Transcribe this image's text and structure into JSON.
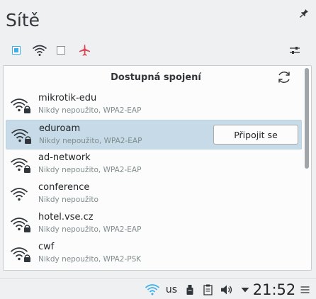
{
  "popup": {
    "title": "Sítě",
    "header_label": "Dostupná spojení",
    "toolbar": {
      "icons": [
        "enable-networking-checkbox-icon",
        "wifi-icon",
        "mobile-broadband-checkbox-icon",
        "airplane-mode-icon",
        "configure-icon"
      ]
    }
  },
  "networks": [
    {
      "name": "mikrotik-edu",
      "detail": "Nikdy nepoužito, WPA2-EAP",
      "secured": true,
      "selected": false
    },
    {
      "name": "eduroam",
      "detail": "Nikdy nepoužito, WPA2-EAP",
      "secured": true,
      "selected": true,
      "button": "Připojit se"
    },
    {
      "name": "ad-network",
      "detail": "Nikdy nepoužito, WPA2-EAP",
      "secured": true,
      "selected": false
    },
    {
      "name": "conference",
      "detail": "Nikdy nepoužito",
      "secured": false,
      "selected": false
    },
    {
      "name": "hotel.vse.cz",
      "detail": "Nikdy nepoužito, WPA2-EAP",
      "secured": true,
      "selected": false
    },
    {
      "name": "cwf",
      "detail": "Nikdy nepoužito, WPA2-PSK",
      "secured": true,
      "selected": false
    }
  ],
  "taskbar": {
    "keyboard_layout": "us",
    "clock": "21:52"
  },
  "colors": {
    "accent": "#3daee9",
    "selection": "#c6dae7",
    "airplane": "#da4453"
  }
}
